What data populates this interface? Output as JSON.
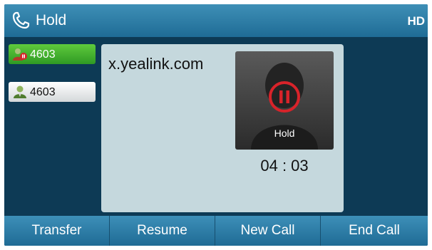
{
  "header": {
    "title": "Hold",
    "hd_badge": "HD",
    "icon": "handset-icon"
  },
  "line_keys": [
    {
      "label": "4603",
      "state": "held",
      "icon": "contact-hold-icon",
      "color": "#3aab2a"
    },
    {
      "label": "4603",
      "state": "idle",
      "icon": "contact-icon"
    }
  ],
  "call": {
    "remote_name": "x.yealink.com",
    "status_label": "Hold",
    "duration": "04 : 03",
    "photo_icon": "person-silhouette-icon",
    "pause_icon": "pause-icon",
    "hold_color": "#d8232a"
  },
  "softkeys": [
    {
      "label": "Transfer"
    },
    {
      "label": "Resume"
    },
    {
      "label": "New Call"
    },
    {
      "label": "End Call"
    }
  ],
  "colors": {
    "background": "#0d3a55",
    "titlebar": "#2b7ca6",
    "panel": "#c5d8dd"
  }
}
